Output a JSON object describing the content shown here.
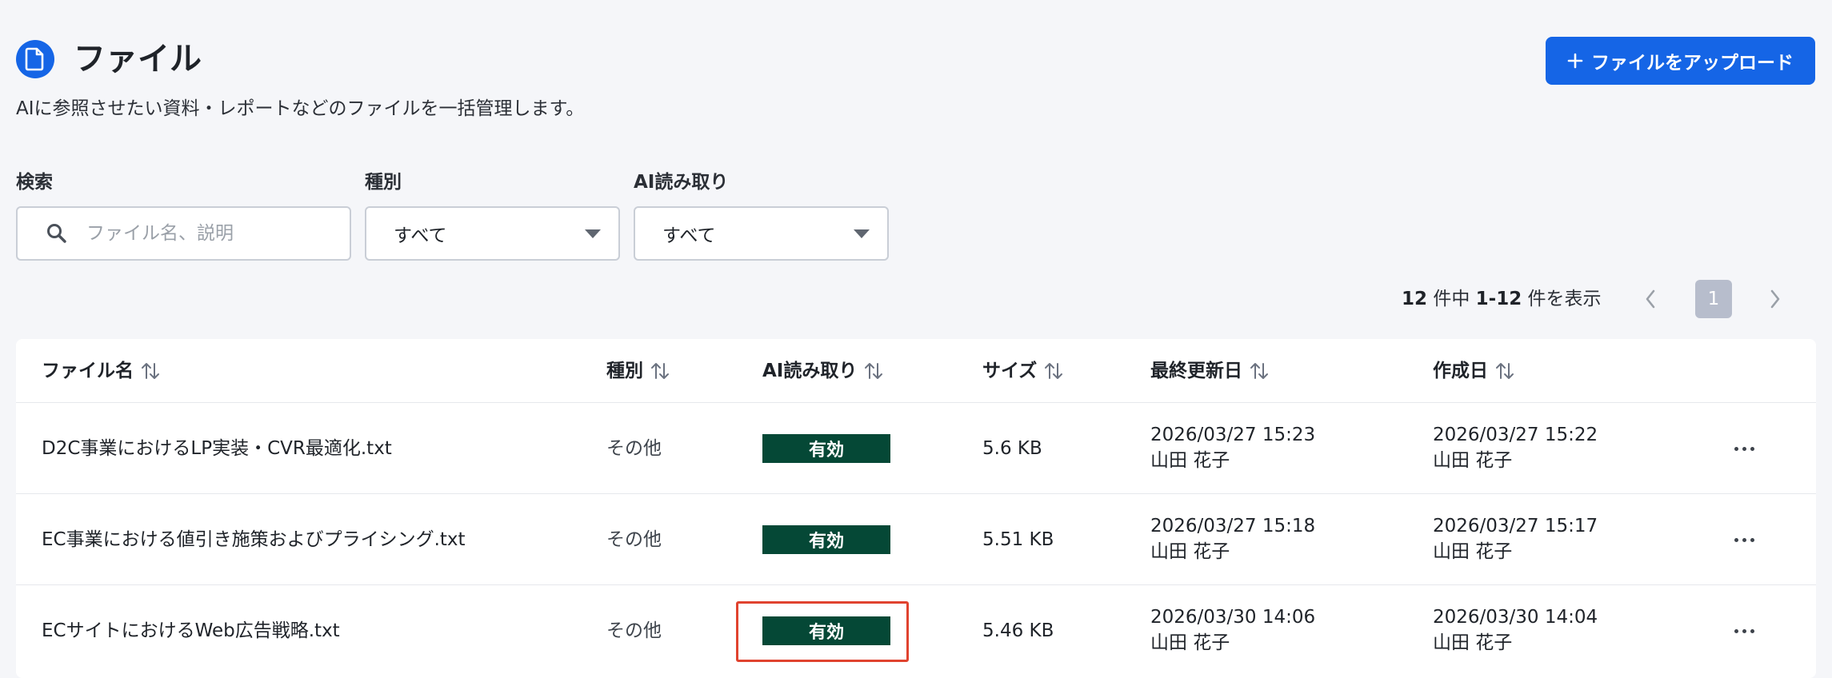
{
  "header": {
    "title": "ファイル",
    "subtitle": "AIに参照させたい資料・レポートなどのファイルを一括管理します。",
    "upload_label": "ファイルをアップロード",
    "accent": "#1565e6"
  },
  "filters": {
    "search_label": "検索",
    "search_placeholder": "ファイル名、説明",
    "type_label": "種別",
    "type_value": "すべて",
    "ai_label": "AI読み取り",
    "ai_value": "すべて"
  },
  "pagination": {
    "total": "12",
    "total_suffix": " 件中 ",
    "range": "1-12",
    "range_suffix": " 件を表示",
    "current_page": "1"
  },
  "table": {
    "columns": [
      "ファイル名",
      "種別",
      "AI読み取り",
      "サイズ",
      "最終更新日",
      "作成日"
    ],
    "rows": [
      {
        "name": "D2C事業におけるLP実装・CVR最適化.txt",
        "type": "その他",
        "ai": "有効",
        "size": "5.6 KB",
        "updated_date": "2026/03/27 15:23",
        "updated_by": "山田 花子",
        "created_date": "2026/03/27 15:22",
        "created_by": "山田 花子"
      },
      {
        "name": "EC事業における値引き施策およびプライシング.txt",
        "type": "その他",
        "ai": "有効",
        "size": "5.51 KB",
        "updated_date": "2026/03/27 15:18",
        "updated_by": "山田 花子",
        "created_date": "2026/03/27 15:17",
        "created_by": "山田 花子"
      },
      {
        "name": "ECサイトにおけるWeb広告戦略.txt",
        "type": "その他",
        "ai": "有効",
        "size": "5.46 KB",
        "updated_date": "2026/03/30 14:06",
        "updated_by": "山田 花子",
        "created_date": "2026/03/30 14:04",
        "created_by": "山田 花子"
      }
    ],
    "badge_color": "#054836",
    "highlight_color": "#e0432f"
  }
}
